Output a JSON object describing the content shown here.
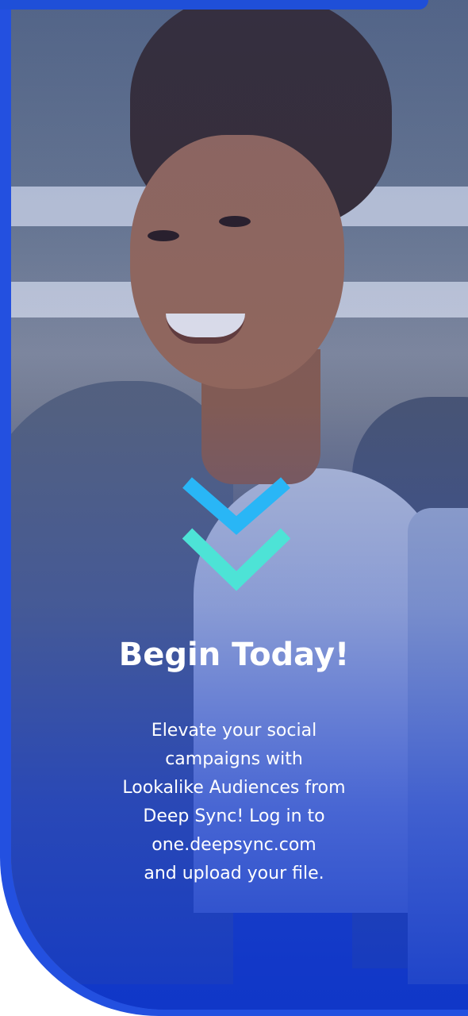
{
  "promo": {
    "headline": "Begin Today!",
    "body_lines": [
      "Elevate your social",
      "campaigns with",
      "Lookalike Audiences from",
      "Deep Sync! Log in to",
      "one.deepsync.com",
      "and upload your file."
    ],
    "scroll_icon": "double-chevron-down-icon"
  },
  "colors": {
    "brand_blue": "#2350e0",
    "chevron_top": "#29b6f6",
    "chevron_bottom": "#4de3d6",
    "text": "#ffffff"
  }
}
